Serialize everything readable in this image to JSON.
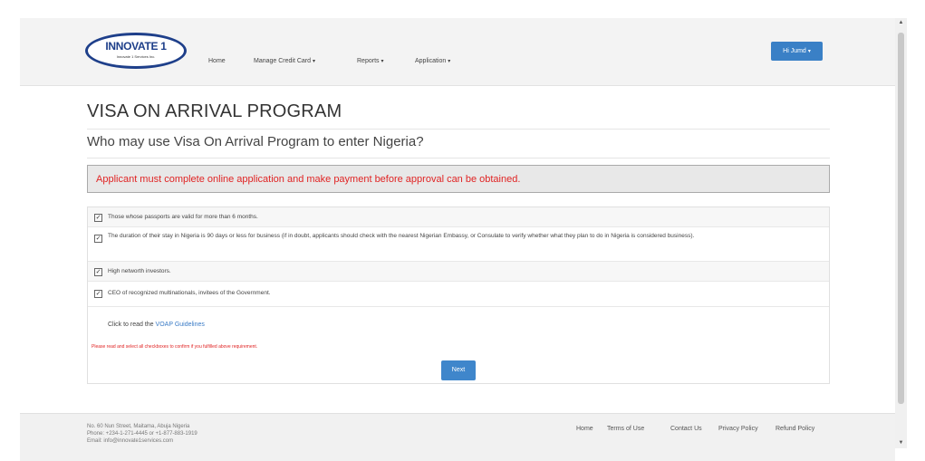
{
  "header": {
    "logo": {
      "title": "INNOVATE 1",
      "subtitle": "Innovate 1 Services Inc."
    },
    "nav": [
      {
        "label": "Home",
        "dropdown": false
      },
      {
        "label": "Manage Credit Card",
        "dropdown": true
      },
      {
        "label": "Reports",
        "dropdown": true
      },
      {
        "label": "Application",
        "dropdown": true
      }
    ],
    "user_label": "Hi Jumd"
  },
  "main": {
    "title": "VISA ON ARRIVAL PROGRAM",
    "subtitle": "Who may use Visa On Arrival Program to enter Nigeria?",
    "alert": "Applicant must complete online application and make payment before approval can be obtained.",
    "criteria": [
      {
        "text": "Those whose passports are valid for more than 6 months.",
        "checked": true
      },
      {
        "text": "The duration of their stay in Nigeria is 90 days or less for business (if in doubt, applicants should check with the nearest Nigerian Embassy, or Consulate to verify whether what they plan to do in Nigeria is considered business).",
        "checked": true
      },
      {
        "text": "High networth investors.",
        "checked": true
      },
      {
        "text": "CEO of recognized multinationals, invitees of the Government.",
        "checked": true
      }
    ],
    "guidelines_prefix": "Click to read the",
    "guidelines_link": "VOAP Guidelines",
    "warning": "Please read and select all checkboxes to confirm if you fulfilled above requirement.",
    "next_label": "Next"
  },
  "footer": {
    "address": [
      "No. 60 Nun Street, Maitama, Abuja Nigeria",
      "Phone: +234-1-271-4445 or +1-877-883-1919",
      "Email: info@innovate1services.com"
    ],
    "links": [
      "Home",
      "Terms of Use",
      "Contact Us",
      "Privacy Policy",
      "Refund Policy"
    ]
  },
  "colors": {
    "accent": "#3a80c6",
    "alert_text": "#e02424",
    "logo_blue": "#1e3f8a"
  },
  "icons": [
    "checkbox-checked-icon",
    "chevron-down-icon",
    "scroll-up-arrow-icon",
    "scroll-down-arrow-icon"
  ]
}
